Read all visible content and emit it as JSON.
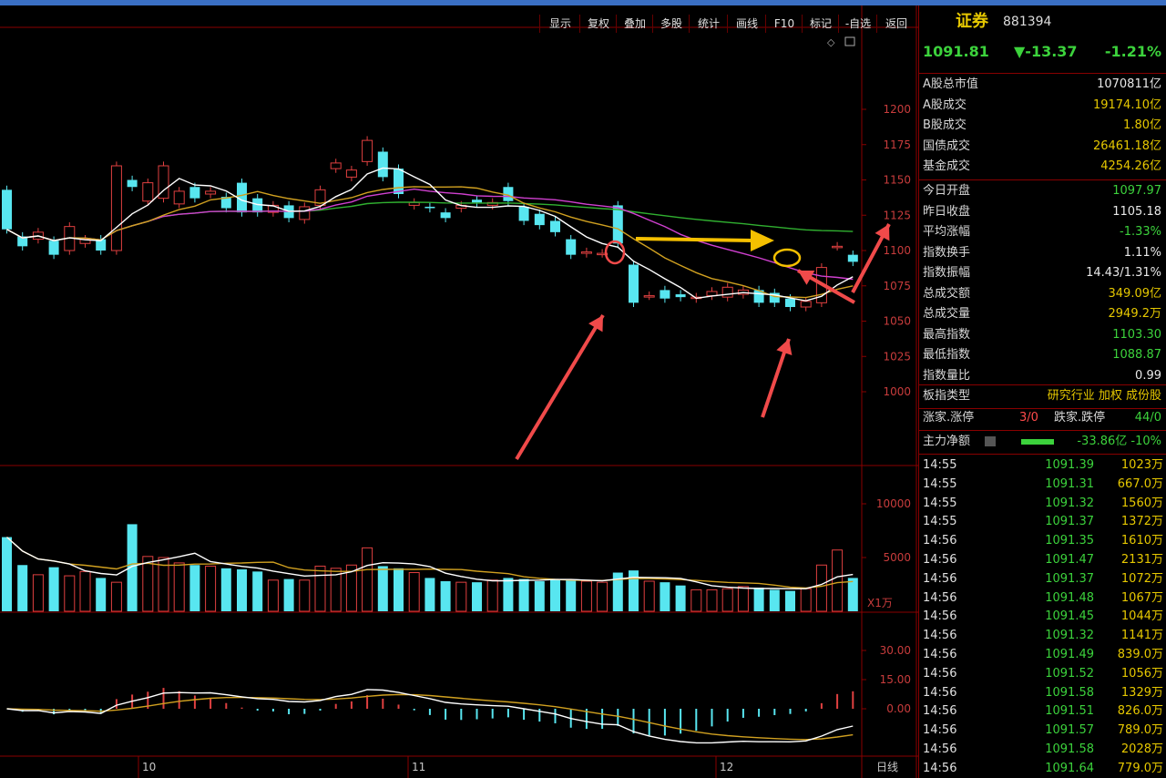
{
  "toolbar": {
    "buttons": [
      "显示",
      "复权",
      "叠加",
      "多股",
      "统计",
      "画线",
      "F10",
      "标记",
      "-自选",
      "返回"
    ]
  },
  "chart": {
    "price_ticks": [
      "1200",
      "1175",
      "1150",
      "1125",
      "1100",
      "1075",
      "1050",
      "1025",
      "1000"
    ],
    "volume_ticks": [
      "10000",
      "5000"
    ],
    "volume_unit": "X1万",
    "macd_ticks": [
      "30.00",
      "15.00",
      "0.00"
    ],
    "x_labels": [
      "10",
      "11",
      "12"
    ],
    "period_label": "日线",
    "colors": {
      "up": "#e04040",
      "down": "#58e6f0",
      "ma5": "#ffffff",
      "ma10": "#d0a020",
      "ma20": "#d040d0",
      "ma60": "#30b030",
      "annotation": "#f04a4a",
      "arrow_yellow": "#f5c000"
    }
  },
  "chart_data": {
    "type": "candlestick",
    "x": [
      "10",
      "11",
      "12"
    ],
    "candles": [
      {
        "o": 1143,
        "c": 1115
      },
      {
        "o": 1110,
        "c": 1103
      },
      {
        "o": 1108,
        "c": 1113
      },
      {
        "o": 1107,
        "c": 1097
      },
      {
        "o": 1100,
        "c": 1117
      },
      {
        "o": 1105,
        "c": 1108
      },
      {
        "o": 1108,
        "c": 1100
      },
      {
        "o": 1100,
        "c": 1160
      },
      {
        "o": 1150,
        "c": 1145
      },
      {
        "o": 1135,
        "c": 1148
      },
      {
        "o": 1137,
        "c": 1160
      },
      {
        "o": 1133,
        "c": 1142
      },
      {
        "o": 1145,
        "c": 1137
      },
      {
        "o": 1140,
        "c": 1142
      },
      {
        "o": 1138,
        "c": 1130
      },
      {
        "o": 1148,
        "c": 1127
      },
      {
        "o": 1137,
        "c": 1127
      },
      {
        "o": 1127,
        "c": 1132
      },
      {
        "o": 1132,
        "c": 1123
      },
      {
        "o": 1122,
        "c": 1131
      },
      {
        "o": 1132,
        "c": 1143
      },
      {
        "o": 1158,
        "c": 1162
      },
      {
        "o": 1152,
        "c": 1157
      },
      {
        "o": 1163,
        "c": 1178
      },
      {
        "o": 1170,
        "c": 1152
      },
      {
        "o": 1158,
        "c": 1140
      },
      {
        "o": 1132,
        "c": 1134
      },
      {
        "o": 1131,
        "c": 1130
      },
      {
        "o": 1127,
        "c": 1123
      },
      {
        "o": 1130,
        "c": 1132
      },
      {
        "o": 1136,
        "c": 1134
      },
      {
        "o": 1132,
        "c": 1134
      },
      {
        "o": 1145,
        "c": 1135
      },
      {
        "o": 1131,
        "c": 1121
      },
      {
        "o": 1126,
        "c": 1118
      },
      {
        "o": 1121,
        "c": 1113
      },
      {
        "o": 1108,
        "c": 1097
      },
      {
        "o": 1098,
        "c": 1099
      },
      {
        "o": 1098,
        "c": 1098
      },
      {
        "o": 1132,
        "c": 1105
      },
      {
        "o": 1090,
        "c": 1063
      },
      {
        "o": 1068,
        "c": 1068
      },
      {
        "o": 1072,
        "c": 1066
      },
      {
        "o": 1069,
        "c": 1067
      },
      {
        "o": 1066,
        "c": 1067
      },
      {
        "o": 1068,
        "c": 1071
      },
      {
        "o": 1067,
        "c": 1074
      },
      {
        "o": 1069,
        "c": 1072
      },
      {
        "o": 1072,
        "c": 1063
      },
      {
        "o": 1070,
        "c": 1063
      },
      {
        "o": 1066,
        "c": 1060
      },
      {
        "o": 1060,
        "c": 1064
      },
      {
        "o": 1063,
        "c": 1088
      },
      {
        "o": 1103,
        "c": 1103
      },
      {
        "o": 1097,
        "c": 1092
      }
    ],
    "volume": [
      6900,
      4300,
      3400,
      4100,
      3300,
      3700,
      3100,
      2700,
      8100,
      5100,
      5000,
      4500,
      4300,
      4200,
      4000,
      3900,
      3700,
      2900,
      3000,
      2900,
      4200,
      4000,
      4300,
      5900,
      4200,
      4000,
      3600,
      3100,
      2800,
      2700,
      2700,
      2900,
      3100,
      3000,
      2800,
      3000,
      2900,
      2800,
      2700,
      3600,
      3800,
      2800,
      2700,
      2400,
      2000,
      2000,
      2100,
      2300,
      2200,
      2000,
      1900,
      2100,
      4300,
      5700,
      3100
    ]
  },
  "sidebar": {
    "title": "证券",
    "code": "881394",
    "price": "1091.81",
    "change": "▼-13.37",
    "change_pct": "-1.21%",
    "stats_a": [
      {
        "k": "A股总市值",
        "v": "1070811亿"
      },
      {
        "k": "A股成交",
        "v": "19174.10亿"
      },
      {
        "k": "B股成交",
        "v": "1.80亿"
      },
      {
        "k": "国债成交",
        "v": "26461.18亿"
      },
      {
        "k": "基金成交",
        "v": "4254.26亿"
      }
    ],
    "stats_b": [
      {
        "k": "今日开盘",
        "v": "1097.97"
      },
      {
        "k": "昨日收盘",
        "v": "1105.18"
      },
      {
        "k": "平均涨幅",
        "v": "-1.33%"
      },
      {
        "k": "指数换手",
        "v": "1.11%"
      },
      {
        "k": "指数振幅",
        "v": "14.43/1.31%"
      },
      {
        "k": "总成交额",
        "v": "349.09亿"
      },
      {
        "k": "总成交量",
        "v": "2949.2万"
      },
      {
        "k": "最高指数",
        "v": "1103.30"
      },
      {
        "k": "最低指数",
        "v": "1088.87"
      },
      {
        "k": "指数量比",
        "v": "0.99"
      }
    ],
    "type_label": "板指类型",
    "type_value": "研究行业 加权 成份股",
    "rise_label": "涨家.涨停",
    "rise_value": "3/0",
    "fall_label": "跌家.跌停",
    "fall_value": "44/0",
    "flow_label": "主力净额",
    "flow_value": "-33.86亿 -10%",
    "ticks": [
      {
        "t": "14:55",
        "p": "1091.39",
        "v": "1023万"
      },
      {
        "t": "14:55",
        "p": "1091.31",
        "v": "667.0万"
      },
      {
        "t": "14:55",
        "p": "1091.32",
        "v": "1560万"
      },
      {
        "t": "14:55",
        "p": "1091.37",
        "v": "1372万"
      },
      {
        "t": "14:56",
        "p": "1091.35",
        "v": "1610万"
      },
      {
        "t": "14:56",
        "p": "1091.47",
        "v": "2131万"
      },
      {
        "t": "14:56",
        "p": "1091.37",
        "v": "1072万"
      },
      {
        "t": "14:56",
        "p": "1091.48",
        "v": "1067万"
      },
      {
        "t": "14:56",
        "p": "1091.45",
        "v": "1044万"
      },
      {
        "t": "14:56",
        "p": "1091.32",
        "v": "1141万"
      },
      {
        "t": "14:56",
        "p": "1091.49",
        "v": "839.0万"
      },
      {
        "t": "14:56",
        "p": "1091.52",
        "v": "1056万"
      },
      {
        "t": "14:56",
        "p": "1091.58",
        "v": "1329万"
      },
      {
        "t": "14:56",
        "p": "1091.51",
        "v": "826.0万"
      },
      {
        "t": "14:56",
        "p": "1091.57",
        "v": "789.0万"
      },
      {
        "t": "14:56",
        "p": "1091.58",
        "v": "2028万"
      },
      {
        "t": "14:56",
        "p": "1091.64",
        "v": "779.0万"
      }
    ]
  }
}
